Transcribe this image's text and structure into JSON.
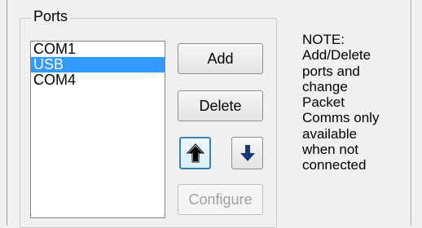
{
  "ports_group": {
    "title": "Ports",
    "items": [
      {
        "label": "COM1",
        "selected": false
      },
      {
        "label": "USB",
        "selected": true
      },
      {
        "label": "COM4",
        "selected": false
      }
    ]
  },
  "buttons": {
    "add_label": "Add",
    "delete_label": "Delete",
    "configure_label": "Configure",
    "configure_enabled": false,
    "move_up_icon": "arrow-up-icon",
    "move_down_icon": "arrow-down-icon"
  },
  "note": {
    "text": "NOTE:\nAdd/Delete\nports and\nchange\nPacket\nComms only\navailable\nwhen not\nconnected"
  },
  "colors": {
    "selection": "#3399ff",
    "disabled_text": "#a0a0a0"
  }
}
